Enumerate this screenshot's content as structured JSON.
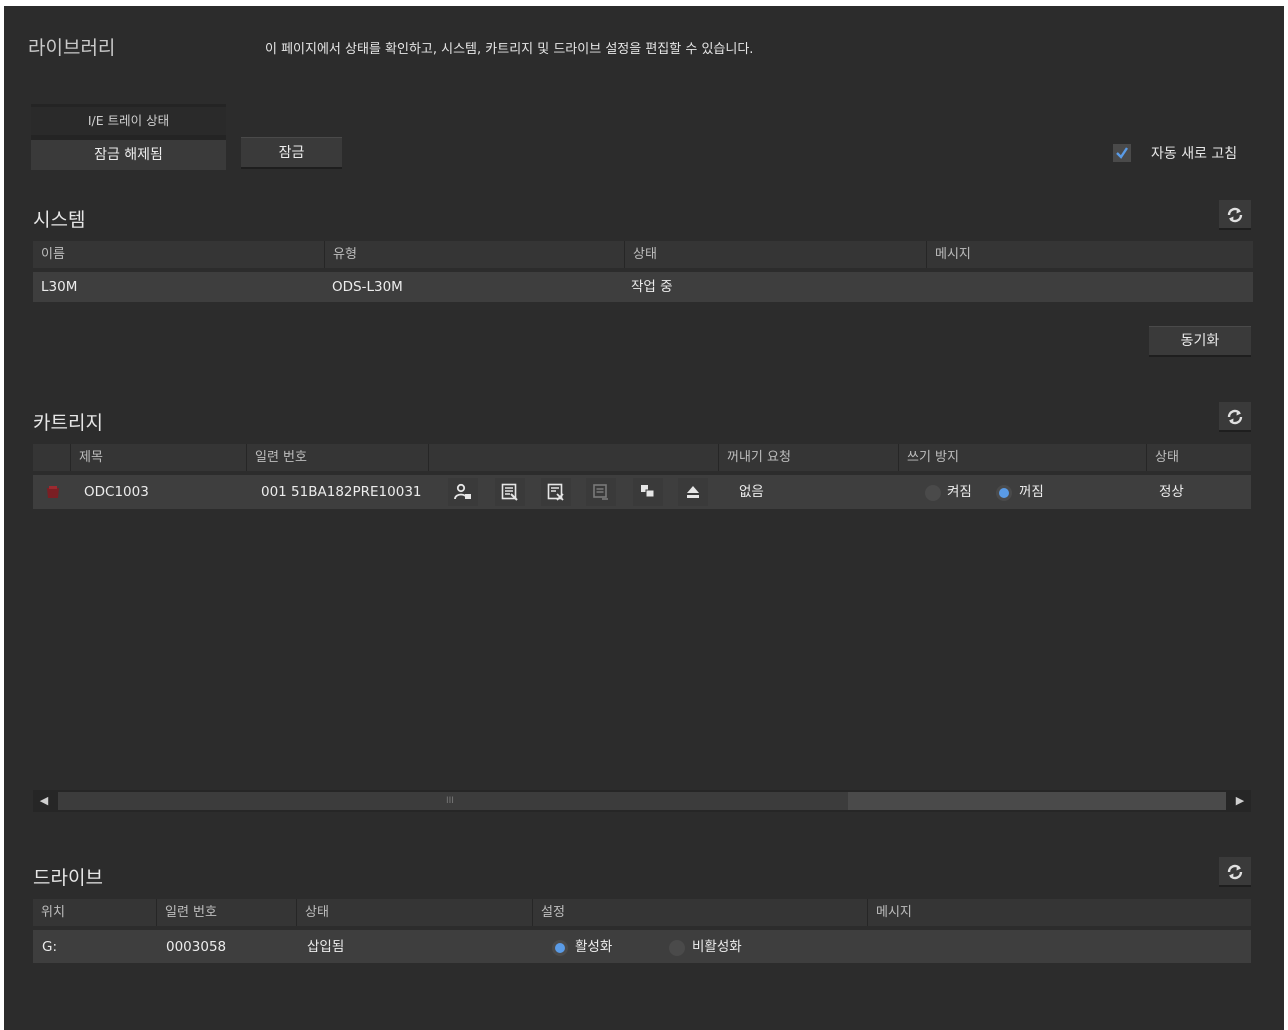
{
  "page": {
    "title": "라이브러리",
    "description": "이 페이지에서 상태를 확인하고, 시스템, 카트리지 및 드라이브 설정을 편집할 수 있습니다."
  },
  "ie_tray": {
    "label": "I/E 트레이 상태",
    "status": "잠금 해제됨",
    "lock_button": "잠금"
  },
  "auto_refresh": {
    "label": "자동 새로 고침",
    "checked": true
  },
  "system": {
    "title": "시스템",
    "columns": [
      "이름",
      "유형",
      "상태",
      "메시지"
    ],
    "row": {
      "name": "L30M",
      "type": "ODS-L30M",
      "status": "작업 중",
      "message": ""
    },
    "sync_button": "동기화"
  },
  "cartridge": {
    "title": "카트리지",
    "columns": [
      "제목",
      "일련 번호",
      "꺼내기 요청",
      "쓰기 방지",
      "상태"
    ],
    "row": {
      "title": "ODC1003",
      "serial": "001 51BA182PRE10031",
      "eject_request": "없음",
      "write_protect_on": "켜짐",
      "write_protect_off": "꺼짐",
      "write_protect_selected": "off",
      "status": "정상"
    },
    "action_icons": [
      "user-settings-icon",
      "edit-list-icon",
      "delete-list-icon",
      "document-icon",
      "copy-icon",
      "eject-icon"
    ],
    "scrollbar_grip": "III"
  },
  "drive": {
    "title": "드라이브",
    "columns": [
      "위치",
      "일련 번호",
      "상태",
      "설정",
      "메시지"
    ],
    "row": {
      "location": "G:",
      "serial": "0003058",
      "status": "삽입됨",
      "setting_enable": "활성화",
      "setting_disable": "비활성화",
      "setting_selected": "enable",
      "message": ""
    }
  },
  "colors": {
    "background": "#2c2c2c",
    "accent": "#5a9be6",
    "row": "#3e3e3e"
  }
}
